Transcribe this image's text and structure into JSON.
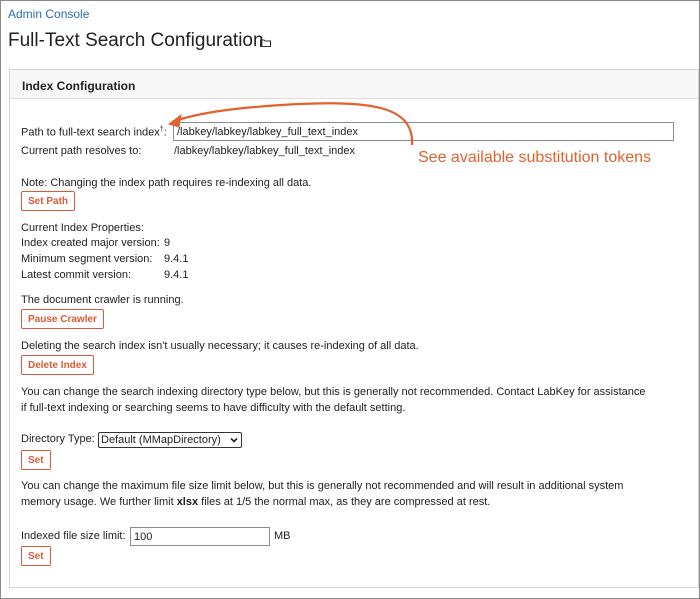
{
  "breadcrumb": "Admin Console",
  "page_title": "Full-Text Search Configuration",
  "panel_title": "Index Configuration",
  "path": {
    "label": "Path to full-text search index",
    "footnote_mark": "†",
    "colon": ":",
    "value": "/labkey/labkey/labkey_full_text_index",
    "resolves_label": "Current path resolves to:",
    "resolves_value": "/labkey/labkey/labkey_full_text_index"
  },
  "callout": "See available substitution tokens",
  "note_reindex": "Note: Changing the index path requires re-indexing all data.",
  "set_path_button": "Set Path",
  "properties": {
    "heading": "Current Index Properties:",
    "created_label": "Index created major version:",
    "created_value": "9",
    "min_segment_label": "Minimum segment version:",
    "min_segment_value": "9.4.1",
    "latest_commit_label": "Latest commit version:",
    "latest_commit_value": "9.4.1"
  },
  "crawler_status": "The document crawler is running.",
  "pause_crawler_button": "Pause Crawler",
  "delete_note": "Deleting the search index isn't usually necessary; it causes re-indexing of all data.",
  "delete_index_button": "Delete Index",
  "directory_note_line1": "You can change the search indexing directory type below, but this is generally not recommended. Contact LabKey for assistance",
  "directory_note_line2": "if full-text indexing or searching seems to have difficulty with the default setting.",
  "directory_type_label": "Directory Type:",
  "directory_type_value": "Default (MMapDirectory)",
  "set_button_1": "Set",
  "filesize_note_line1": "You can change the maximum file size limit below, but this is generally not recommended and will result in additional system",
  "filesize_note_line2_pre": "memory usage. We further limit ",
  "filesize_note_line2_kw": "xlsx",
  "filesize_note_line2_post": " files at 1/5 the normal max, as they are compressed at rest.",
  "filesize_label": "Indexed file size limit:",
  "filesize_value": "100",
  "filesize_unit": "MB",
  "set_button_2": "Set",
  "colors": {
    "accent": "#d85a3a",
    "callout": "#e1622f",
    "link": "#2b6cb0"
  },
  "icons": [
    "folder-icon",
    "chevron-down-icon",
    "callout-arrow"
  ]
}
